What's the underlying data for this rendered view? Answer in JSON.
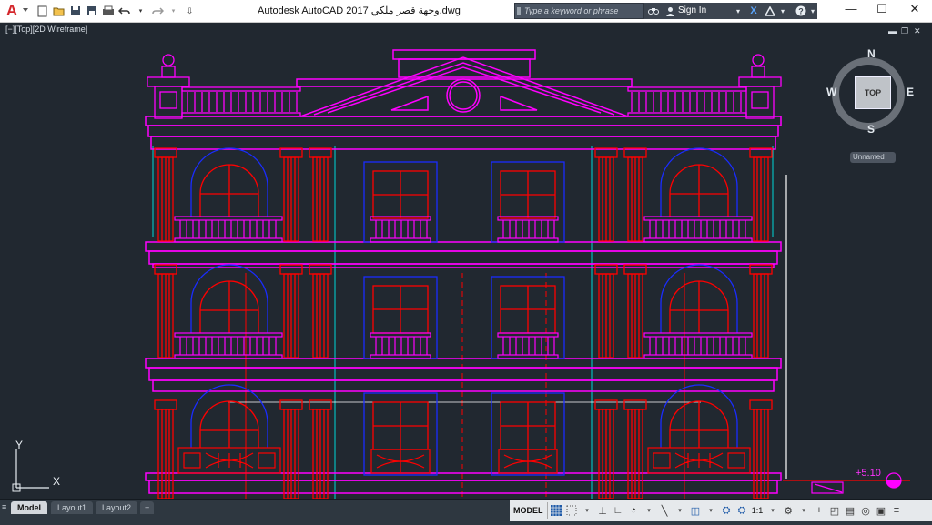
{
  "app": {
    "logo": "A",
    "title": "Autodesk AutoCAD 2017   وجهة قصر ملكي.dwg"
  },
  "quick_access": {
    "icons": [
      "new-file-icon",
      "open-file-icon",
      "save-icon",
      "save-as-icon",
      "plot-icon",
      "undo-icon",
      "redo-icon",
      "customize-icon"
    ]
  },
  "search": {
    "placeholder": "Type a keyword or phrase"
  },
  "header": {
    "signin_label": "Sign In"
  },
  "viewport": {
    "label": "[−][Top][2D Wireframe]"
  },
  "viewcube": {
    "top_label": "TOP",
    "north": "N",
    "south": "S",
    "east": "E",
    "west": "W",
    "ucs_menu": "Unnamed"
  },
  "drawing": {
    "elevation_label": "+5.10",
    "colors": {
      "magenta": "#ff00ff",
      "red": "#ff0000",
      "blue": "#1a2cff",
      "cyan": "#00d8d8",
      "white": "#ffffff"
    }
  },
  "ucs": {
    "y": "Y",
    "x": "X"
  },
  "layout_tabs": [
    "Model",
    "Layout1",
    "Layout2",
    "+"
  ],
  "status": {
    "model_label": "MODEL",
    "scale_label": "1:1"
  }
}
